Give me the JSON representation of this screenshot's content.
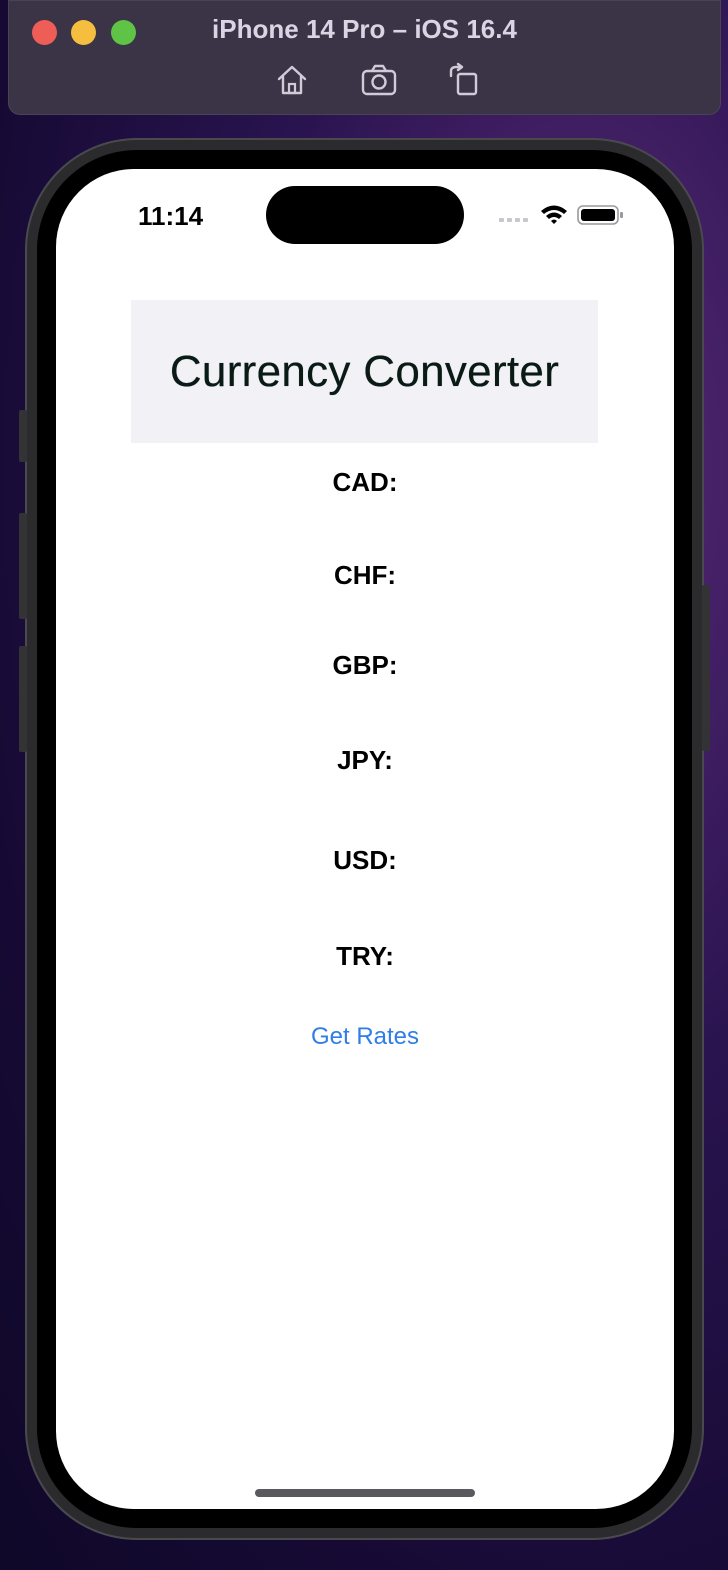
{
  "simulator": {
    "title": "iPhone 14 Pro – iOS 16.4",
    "toolbar": [
      "home-icon",
      "screenshot-icon",
      "rotate-icon"
    ]
  },
  "status_bar": {
    "time": "11:14"
  },
  "app": {
    "title": "Currency Converter",
    "rates": [
      {
        "label": "CAD:"
      },
      {
        "label": "CHF:"
      },
      {
        "label": "GBP:"
      },
      {
        "label": "JPY:"
      },
      {
        "label": "USD:"
      },
      {
        "label": "TRY:"
      }
    ],
    "get_rates_label": "Get Rates"
  },
  "colors": {
    "accent": "#2f7ee6",
    "header_bg": "#f1f1f6"
  }
}
